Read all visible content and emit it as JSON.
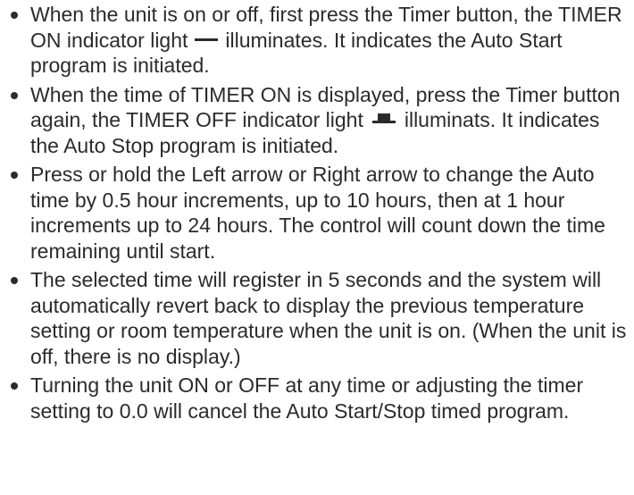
{
  "bullets": [
    {
      "before_indicator": "When the unit is on or off, first press the Timer button, the TIMER ON indicator light",
      "indicator": "timer-on-dash-icon",
      "after_indicator": "illuminates. It indicates the Auto Start program is initiated."
    },
    {
      "before_indicator": "When the time of TIMER ON is displayed, press the Timer button again, the TIMER OFF indicator light",
      "indicator": "timer-off-step-icon",
      "after_indicator": "illuminats. It indicates the Auto Stop program is initiated."
    },
    {
      "text": "Press or hold the Left arrow or Right arrow to change the Auto time by 0.5 hour increments, up to 10 hours, then at 1 hour increments up to 24 hours. The control will count down the time remaining until start."
    },
    {
      "text": "The selected time will register in 5 seconds and the system will automatically revert back to display the previous temperature setting or room temperature when the unit is on. (When the unit is off, there is no display.)"
    },
    {
      "text": "Turning the unit ON or OFF at any time or adjusting the timer setting to 0.0 will cancel the Auto Start/Stop timed program."
    }
  ]
}
